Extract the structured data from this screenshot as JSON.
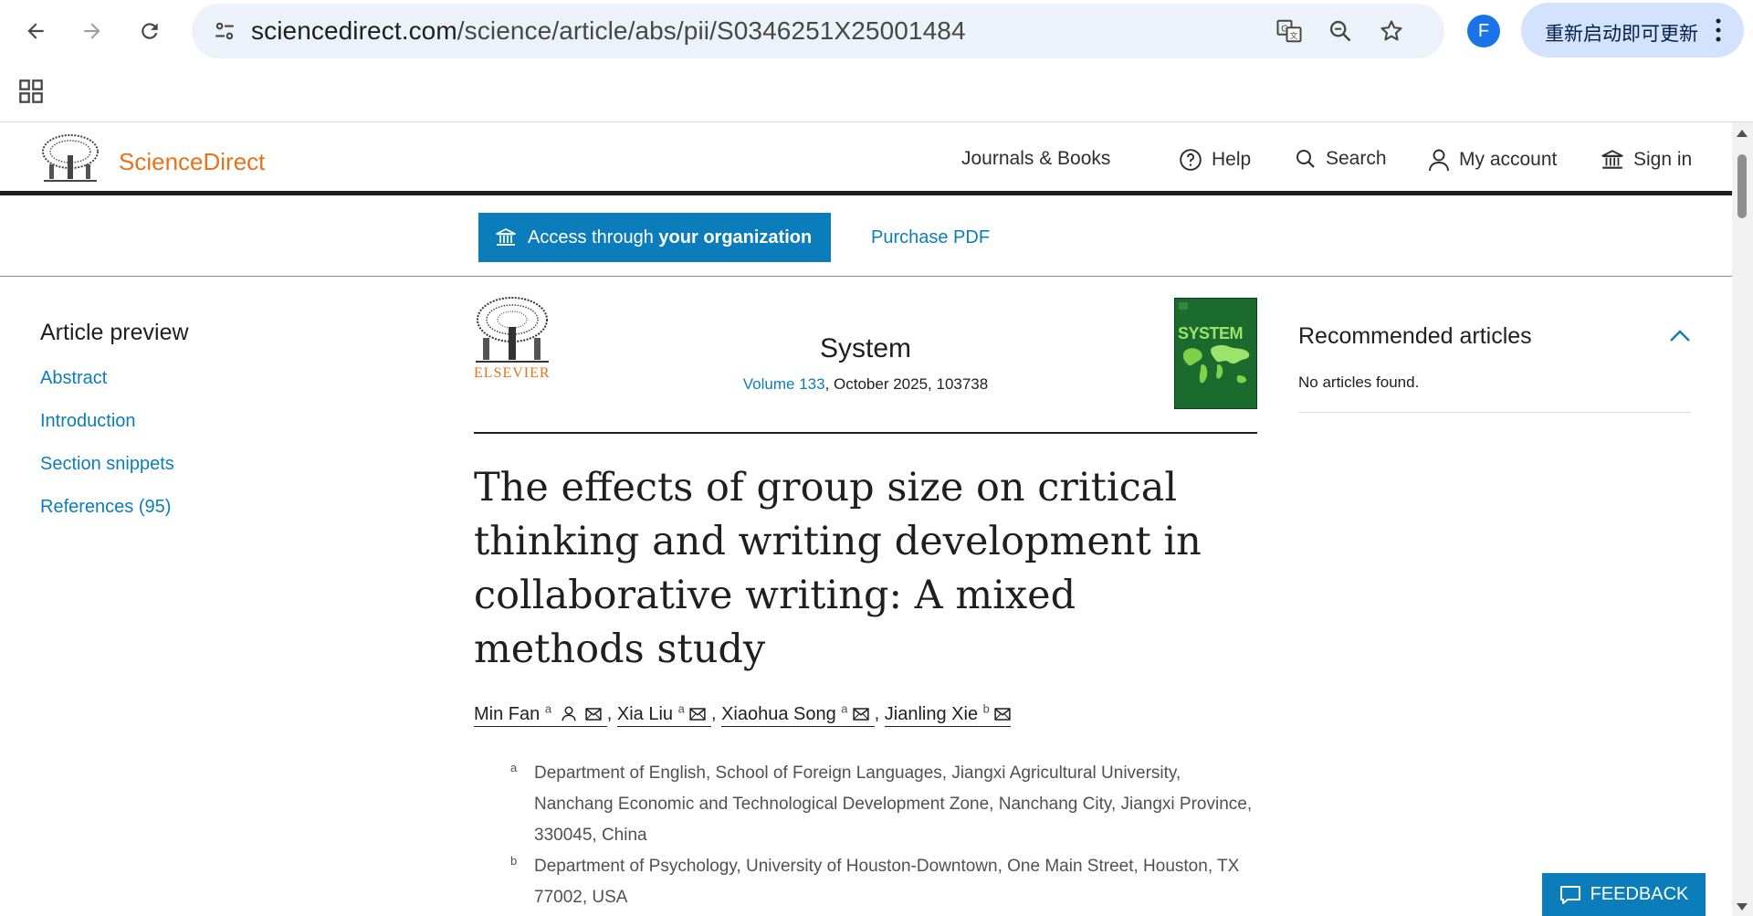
{
  "browser": {
    "url_host": "sciencedirect.com",
    "url_path": "/science/article/abs/pii/S0346251X25001484",
    "profile_initial": "F",
    "update_label": "重新启动即可更新",
    "icons": [
      "back-arrow-icon",
      "forward-arrow-icon",
      "reload-icon",
      "site-info-icon",
      "translate-icon",
      "zoom-icon",
      "bookmark-star-icon",
      "kebab-menu-icon",
      "apps-grid-icon"
    ]
  },
  "header": {
    "brand": "ScienceDirect",
    "journals_books": "Journals & Books",
    "help": "Help",
    "search": "Search",
    "my_account": "My account",
    "sign_in": "Sign in"
  },
  "access": {
    "access_prefix": "Access through ",
    "access_bold": "your organization",
    "purchase": "Purchase PDF"
  },
  "left_nav": {
    "heading": "Article preview",
    "items": [
      "Abstract",
      "Introduction",
      "Section snippets",
      "References (95)"
    ]
  },
  "journal": {
    "publisher": "ELSEVIER",
    "name": "System",
    "volume": "Volume 133",
    "date_article": ", October 2025, 103738",
    "cover_title": "SYSTEM"
  },
  "article": {
    "title": "The effects of group size on critical thinking and writing development in collaborative writing: A mixed methods study",
    "authors": [
      {
        "name": "Min Fan",
        "sup": "a"
      },
      {
        "name": "Xia Liu",
        "sup": "a"
      },
      {
        "name": "Xiaohua Song",
        "sup": "a"
      },
      {
        "name": "Jianling Xie",
        "sup": "b"
      }
    ],
    "separator": ", ",
    "affiliations": [
      {
        "sup": "a",
        "text": "Department of English, School of Foreign Languages, Jiangxi Agricultural University, Nanchang Economic and Technological Development Zone, Nanchang City, Jiangxi Province, 330045, China"
      },
      {
        "sup": "b",
        "text": "Department of Psychology, University of Houston-Downtown, One Main Street, Houston, TX 77002, USA"
      }
    ]
  },
  "recommended": {
    "title": "Recommended articles",
    "empty": "No articles found."
  },
  "feedback": {
    "label": "FEEDBACK"
  },
  "colors": {
    "brand_orange": "#e9711c",
    "link_blue": "#0c7dbb",
    "omnibox_bg": "#edf2fa",
    "update_bg": "#d3e3fd"
  }
}
